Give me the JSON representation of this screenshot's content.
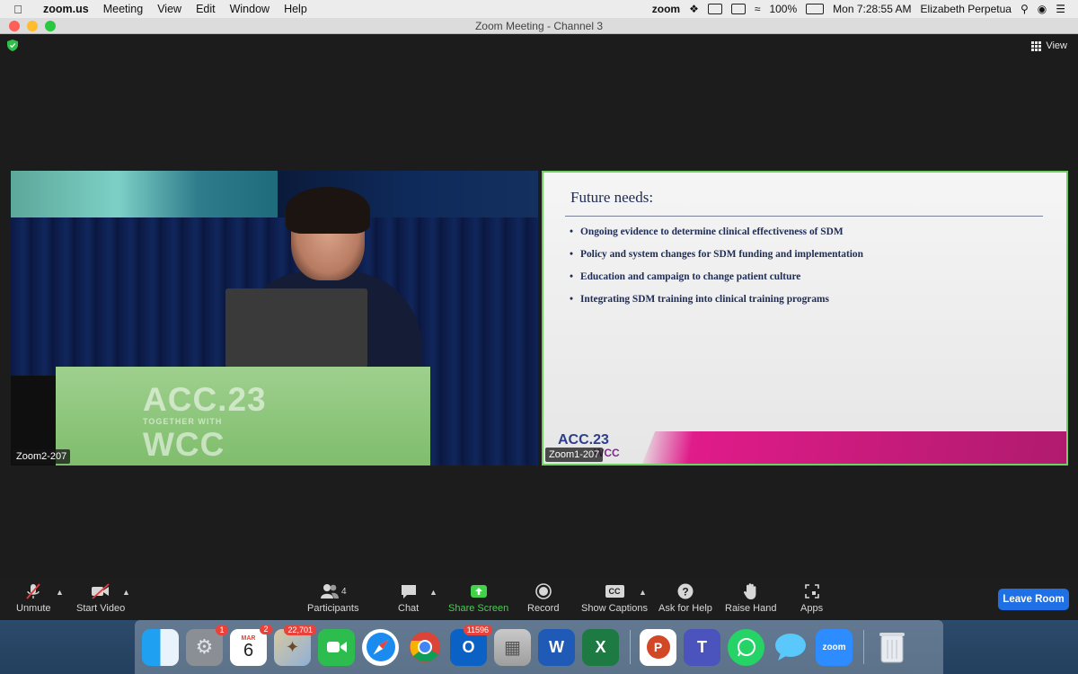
{
  "menubar": {
    "app_name": "zoom.us",
    "items": [
      "Meeting",
      "View",
      "Edit",
      "Window",
      "Help"
    ],
    "status_zoom": "zoom",
    "battery": "100%",
    "clock": "Mon 7:28:55 AM",
    "user": "Elizabeth Perpetua"
  },
  "window": {
    "title": "Zoom Meeting - Channel 3"
  },
  "meeting": {
    "view_label": "View",
    "tiles": [
      {
        "name": "Zoom2-207"
      },
      {
        "name": "Zoom1-207"
      }
    ],
    "podium_logo": {
      "line1": "ACC.23",
      "line2": "TOGETHER WITH",
      "line3": "WCC"
    },
    "slide": {
      "title": "Future needs:",
      "bullets": [
        "Ongoing evidence to determine clinical effectiveness of SDM",
        "Policy and system changes for SDM funding and implementation",
        "Education and campaign to change patient culture",
        "Integrating SDM training into clinical training programs"
      ],
      "logo": "ACC.23",
      "logo_sub": "WCC"
    }
  },
  "toolbar": {
    "unmute": "Unmute",
    "start_video": "Start Video",
    "participants": "Participants",
    "participants_count": "4",
    "chat": "Chat",
    "share_screen": "Share Screen",
    "record": "Record",
    "show_captions": "Show Captions",
    "captions_icon": "CC",
    "ask_help": "Ask for Help",
    "raise_hand": "Raise Hand",
    "apps": "Apps",
    "leave": "Leave Room"
  },
  "dock": {
    "calendar_month": "MAR",
    "calendar_day": "6",
    "badges": {
      "system_prefs": "1",
      "calendar": "2",
      "mail": "22,701",
      "outlook": "11596"
    },
    "zoom_label": "zoom"
  },
  "colors": {
    "active_border": "#6fd260",
    "leave_button": "#1f6fe5",
    "share_green": "#42d24a"
  }
}
